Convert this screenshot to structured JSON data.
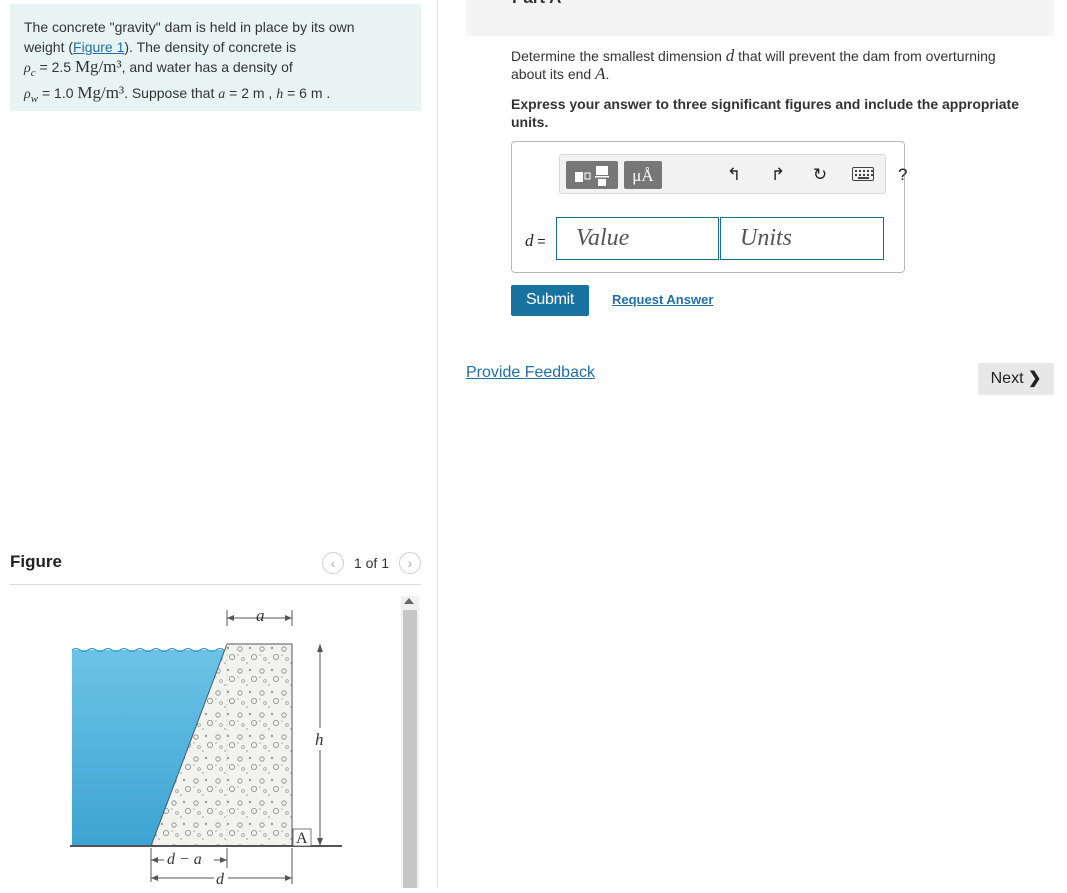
{
  "problem": {
    "line1": "The concrete \"gravity\" dam is held in place by its own",
    "line2_before": "weight (",
    "figure_link": "Figure 1",
    "line2_after": "). The density of concrete is",
    "rho_c_symbol": "ρ",
    "rho_c_sub": "c",
    "rho_c_value": " = 2.5 ",
    "rho_c_unit": "Mg/m³",
    "line3_mid": ", and water has a density of",
    "rho_w_symbol": "ρ",
    "rho_w_sub": "w",
    "rho_w_value": " = 1.0 ",
    "rho_w_unit": "Mg/m³",
    "line4": ". Suppose that ",
    "a_var": "a",
    "a_val": " = 2  m , ",
    "h_var": "h",
    "h_val": " = 6  m ."
  },
  "figure": {
    "title": "Figure",
    "pager": "1 of 1",
    "labels": {
      "a": "a",
      "h": "h",
      "A": "A",
      "d_minus_a": "d − a",
      "d": "d"
    }
  },
  "part": {
    "label": "Part A"
  },
  "question": {
    "text1": "Determine the smallest dimension ",
    "var": "d",
    "text2": " that will prevent the dam from overturning",
    "text3": "about its end ",
    "end": "A",
    "text4": "."
  },
  "instructions": "Express your answer to three significant figures and include the appropriate units.",
  "answer": {
    "label_var": "d",
    "label_eq": " =",
    "value_placeholder": "Value",
    "units_placeholder": "Units",
    "toolbar_units_symbol": "μÅ"
  },
  "buttons": {
    "submit": "Submit",
    "request_answer": "Request Answer",
    "provide_feedback": "Provide Feedback",
    "next": "Next",
    "help": "?"
  },
  "colors": {
    "problem_bg": "#e8f4f4",
    "link": "#1f6fa8",
    "submit_bg": "#1873a0",
    "input_border": "#1b6d8f",
    "water": "#5db7de"
  }
}
